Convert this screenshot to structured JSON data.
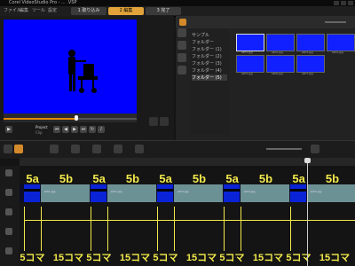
{
  "window": {
    "title": "Corel VideoStudio Pro - ... .VSP"
  },
  "menu": [
    "ファイル",
    "編集",
    "ツール",
    "設定"
  ],
  "tabs": [
    {
      "label": "1 取り込み",
      "active": false
    },
    {
      "label": "2 編集",
      "active": true
    },
    {
      "label": "3 完了",
      "active": false
    }
  ],
  "preview": {
    "mode_label": "Project",
    "clip_label": "Clip",
    "screen_color": "#0000ff"
  },
  "library": {
    "folders": [
      "サンプル",
      "フォルダー",
      "フォルダー (1)",
      "フォルダー (2)",
      "フォルダー (3)",
      "フォルダー (4)",
      "フォルダー (5)"
    ],
    "selected_folder": 6,
    "thumb_labels": [
      "silh1.jpg",
      "silh2.jpg",
      "silh3.jpg",
      "silh4.jpg",
      "silh5.jpg",
      "silh6.jpg",
      "silh7.jpg"
    ]
  },
  "timeline": {
    "clips": [
      {
        "type": "blue",
        "label": "",
        "start": 0,
        "len": 5
      },
      {
        "type": "photo",
        "label": "silh1.jpg",
        "start": 5,
        "len": 15
      },
      {
        "type": "blue",
        "label": "",
        "start": 20,
        "len": 5
      },
      {
        "type": "photo",
        "label": "silh2.jpg",
        "start": 25,
        "len": 15
      },
      {
        "type": "blue",
        "label": "",
        "start": 40,
        "len": 5
      },
      {
        "type": "photo",
        "label": "silh3.jpg",
        "start": 45,
        "len": 15
      },
      {
        "type": "blue",
        "label": "",
        "start": 60,
        "len": 5
      },
      {
        "type": "photo",
        "label": "silh4.jpg",
        "start": 65,
        "len": 15
      },
      {
        "type": "blue",
        "label": "",
        "start": 80,
        "len": 5
      },
      {
        "type": "photo",
        "label": "silh5.jpg",
        "start": 85,
        "len": 15
      }
    ]
  },
  "annotations": {
    "top": [
      "5a",
      "5b",
      "5a",
      "5b",
      "5a",
      "5b",
      "5a",
      "5b",
      "5a",
      "5b"
    ],
    "bottom": [
      "5コマ",
      "15コマ",
      "5コマ",
      "15コマ",
      "5コマ",
      "15コマ",
      "5コマ",
      "15コマ",
      "5コマ",
      "15コマ"
    ],
    "color": "#f2e94b"
  }
}
